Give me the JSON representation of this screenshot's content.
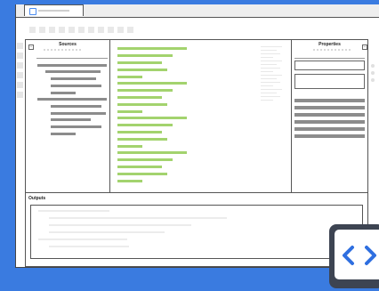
{
  "window": {
    "tab_label": ""
  },
  "sources_panel": {
    "title": "Sources"
  },
  "properties_panel": {
    "title": "Properties"
  },
  "outputs_panel": {
    "title": "Outputs"
  },
  "colors": {
    "background": "#3a7be0",
    "tree_item": "#8c8c8c",
    "code_line": "#a3d36e",
    "code_badge": "#3d4452",
    "code_icon": "#2f6fe0"
  },
  "icons": {
    "tab_icon": "app-icon",
    "collapse_left": "collapse-icon",
    "collapse_right": "collapse-icon",
    "code_badge": "code-brackets-icon"
  }
}
